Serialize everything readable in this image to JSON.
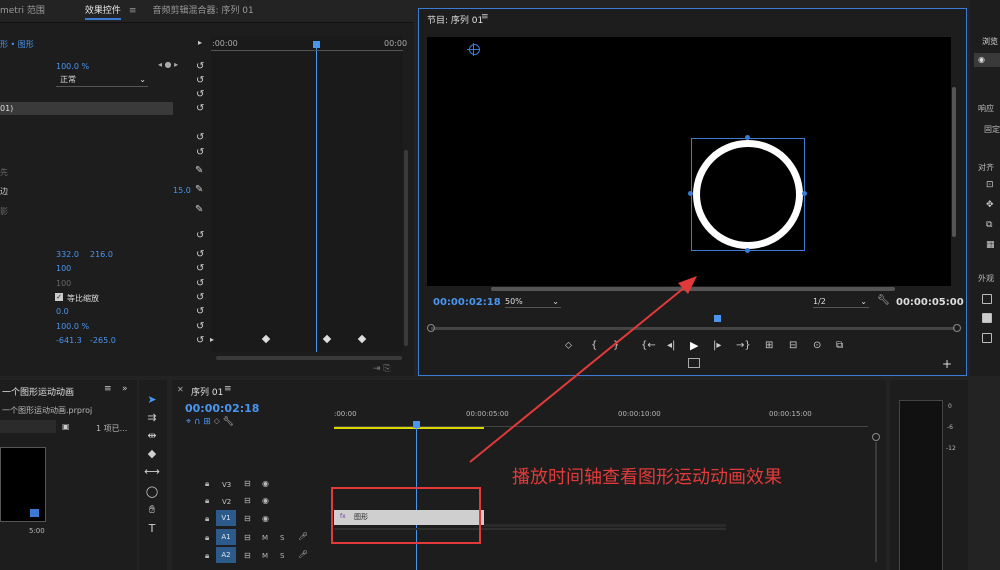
{
  "effect_controls": {
    "tabs": [
      "metri 范围",
      "效果控件",
      "音频剪辑混合器: 序列 01"
    ],
    "clip_label": "形 • 图形",
    "timecode_start": ":00:00",
    "timecode_end": "00:00",
    "opacity_value": "100.0 %",
    "blend_mode": "正常",
    "layer_label": "01)",
    "side_label_1": "先",
    "side_label_2": "边",
    "side_label_3": "影",
    "stroke_width": "15.0",
    "position_x": "332.0",
    "position_y": "216.0",
    "scale": "100",
    "scale_width": "100",
    "uniform_scale": "等比缩放",
    "rotation": "0.0",
    "opacity2": "100.0 %",
    "anchor_x": "-641.3",
    "anchor_y": "-265.0"
  },
  "program_monitor": {
    "title": "节目: 序列 01",
    "timecode": "00:00:02:18",
    "zoom": "50%",
    "resolution": "1/2",
    "duration": "00:00:05:00"
  },
  "right_panel": {
    "tab": "浏览",
    "label_1": "响应",
    "label_2": "固定",
    "label_3": "对齐",
    "label_4": "外观"
  },
  "project_panel": {
    "tab": "一个图形运动动画",
    "file": "一个图形运动动画.prproj",
    "item_count": "1 项已...",
    "thumb_duration": "5:00"
  },
  "timeline": {
    "tab": "序列 01",
    "timecode": "00:00:02:18",
    "ruler": [
      ":00:00",
      "00:00:05:00",
      "00:00:10:00",
      "00:00:15:00"
    ],
    "tracks_video": [
      "V3",
      "V2",
      "V1"
    ],
    "tracks_audio": [
      "A1",
      "A2"
    ],
    "clip_name": "图形",
    "m_label": "M",
    "s_label": "S"
  },
  "meter": {
    "labels": [
      "0",
      "-6",
      "-12"
    ]
  },
  "annotation": {
    "text": "播放时间轴查看图形运动动画效果"
  },
  "colors": {
    "accent": "#3b7bd6",
    "annotation": "#e23a3a",
    "clip": "#cfcfcf"
  }
}
